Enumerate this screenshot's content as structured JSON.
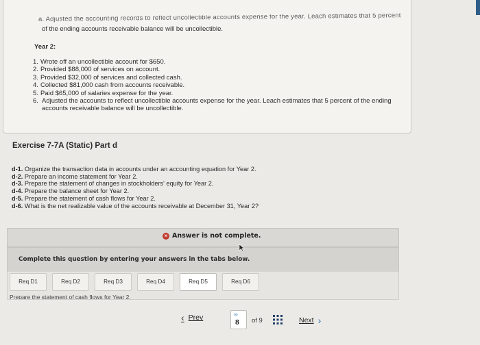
{
  "problem": {
    "cut_line": "a. Adjusted the accounting records to reflect uncollectible accounts expense for the year. Leach estimates that 5 percent",
    "intro_line": "of the ending accounts receivable balance will be uncollectible.",
    "year_label": "Year 2:",
    "items": [
      {
        "num": "1.",
        "text": "Wrote off an uncollectible account for $650."
      },
      {
        "num": "2.",
        "text": "Provided $88,000 of services on account."
      },
      {
        "num": "3.",
        "text": "Provided $32,000 of services and collected cash."
      },
      {
        "num": "4.",
        "text": "Collected $81,000 cash from accounts receivable."
      },
      {
        "num": "5.",
        "text": "Paid $65,000 of salaries expense for the year."
      },
      {
        "num": "6.",
        "text": "Adjusted the accounts to reflect uncollectible accounts expense for the year. Leach estimates that 5 percent of the ending accounts receivable balance will be uncollectible."
      }
    ]
  },
  "exercise": {
    "title": "Exercise 7-7A (Static) Part d",
    "requirements": [
      {
        "code": "d-1.",
        "text": "Organize the transaction data in accounts under an accounting equation for Year 2."
      },
      {
        "code": "d-2.",
        "text": "Prepare an income statement for Year 2."
      },
      {
        "code": "d-3.",
        "text": "Prepare the statement of changes in stockholders' equity for Year 2."
      },
      {
        "code": "d-4.",
        "text": "Prepare the balance sheet for Year 2."
      },
      {
        "code": "d-5.",
        "text": "Prepare the statement of cash flows for Year 2."
      },
      {
        "code": "d-6.",
        "text": "What is the net realizable value of the accounts receivable at December 31, Year 2?"
      }
    ]
  },
  "answer": {
    "status": "Answer is not complete.",
    "instruction": "Complete this question by entering your answers in the tabs below."
  },
  "tabs": [
    {
      "label": "Req D1"
    },
    {
      "label": "Req D2"
    },
    {
      "label": "Req D3"
    },
    {
      "label": "Req D4"
    },
    {
      "label": "Req D5"
    },
    {
      "label": "Req D6"
    }
  ],
  "tab_note": "Prepare the statement of cash flows for Year 2.",
  "pager": {
    "prev_label": "Prev",
    "current_page": "8",
    "of_label": "of 9",
    "next_label": "Next"
  },
  "colors": {
    "error_icon": "#c0392b",
    "link_blue": "#2a6fb3"
  }
}
